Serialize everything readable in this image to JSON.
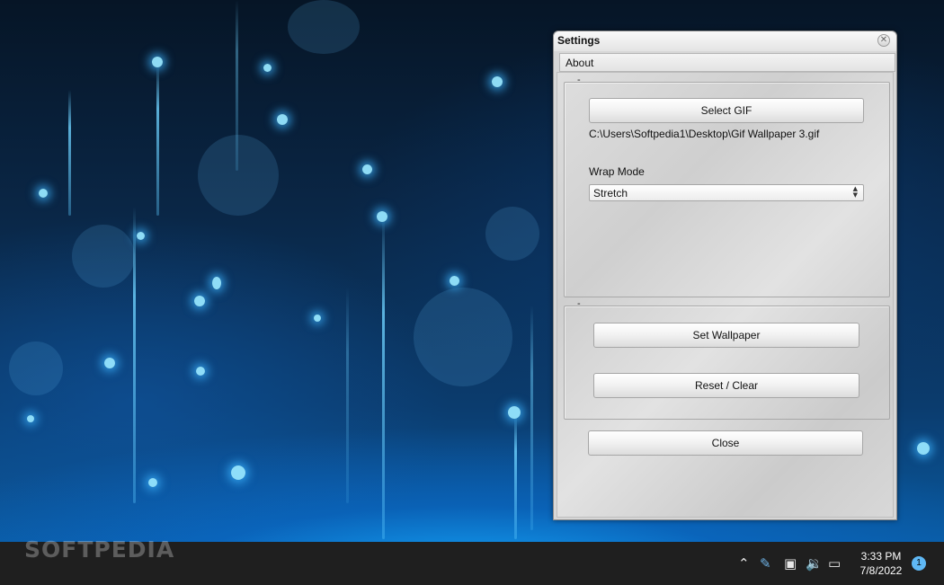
{
  "desktop": {
    "watermark": "SOFTPEDIA"
  },
  "window": {
    "title": "Settings",
    "close_glyph": "✕",
    "menu": [
      "About"
    ],
    "group1": {
      "header": "-",
      "select_gif_label": "Select GIF",
      "file_path": "C:\\Users\\Softpedia1\\Desktop\\Gif Wallpaper 3.gif",
      "wrap_mode_label": "Wrap Mode",
      "wrap_mode_value": "Stretch"
    },
    "group2": {
      "header": "-",
      "set_wallpaper_label": "Set Wallpaper",
      "reset_label": "Reset / Clear"
    },
    "close_label": "Close"
  },
  "taskbar": {
    "time": "3:33 PM",
    "date": "7/8/2022",
    "notification_count": "1",
    "tray_icons": [
      "chevron-up-icon",
      "pen-icon",
      "network-icon",
      "speaker-icon",
      "battery-icon"
    ],
    "tray_glyphs": [
      "⌃",
      "✎",
      "▣",
      "🔉",
      "▭"
    ]
  },
  "colors": {
    "taskbar": "#1f1f1f",
    "notification_badge": "#5fb8f5",
    "window_bg": "#d7d7d7"
  }
}
